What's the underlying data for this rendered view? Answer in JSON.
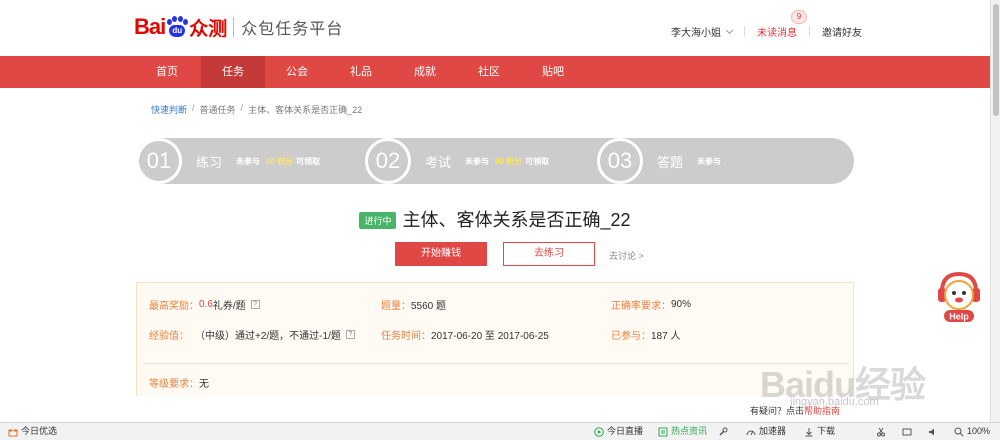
{
  "header": {
    "logo_bai": "Bai",
    "logo_du": "du",
    "logo_product": "众测",
    "logo_subtitle": "众包任务平台",
    "user_name": "李大海小姐",
    "unread_label": "未读消息",
    "unread_count": "9",
    "invite_label": "邀请好友"
  },
  "nav": {
    "items": [
      {
        "label": "首页"
      },
      {
        "label": "任务"
      },
      {
        "label": "公会"
      },
      {
        "label": "礼品"
      },
      {
        "label": "成就"
      },
      {
        "label": "社区"
      },
      {
        "label": "贴吧"
      }
    ],
    "active_index": 1
  },
  "breadcrumb": {
    "items": [
      "快速判断",
      "普通任务",
      "主体、客体关系是否正确_22"
    ]
  },
  "steps": [
    {
      "num": "01",
      "name": "练习",
      "status": "未参与",
      "score": "20 积分",
      "grab": "可领取"
    },
    {
      "num": "02",
      "name": "考试",
      "status": "未参与",
      "score": "50 积分",
      "grab": "可领取"
    },
    {
      "num": "03",
      "name": "答题",
      "status": "未参与"
    }
  ],
  "task": {
    "status_badge": "进行中",
    "title": "主体、客体关系是否正确_22",
    "start_button": "开始赚钱",
    "practice_button": "去练习",
    "discuss_link": "去讨论 >"
  },
  "info": {
    "reward_label": "最高奖励：",
    "reward_value": "0.6",
    "reward_unit": " 礼券/题",
    "qty_label": "题量：",
    "qty_value": "5560 题",
    "accuracy_label": "正确率要求：",
    "accuracy_value": "90%",
    "exp_label": "经验值：",
    "exp_value": "（中级）通过+2/题，不通过-1/题",
    "time_label": "任务时间：",
    "time_value": "2017-06-20 至 2017-06-25",
    "joined_label": "已参与：",
    "joined_value": "187 人",
    "level_label": "等级要求：",
    "level_value": "无",
    "qmark": "?"
  },
  "help": {
    "question": "有疑问？点击",
    "link": "帮助指南",
    "mascot_label": "Help"
  },
  "watermark": {
    "main": "Baidu经验",
    "sub": "jingyan.baidu.com"
  },
  "statusbar": {
    "left": "今日优选",
    "live": "今日直播",
    "hot": "热点资讯",
    "accelerator": "加速器",
    "download": "下载",
    "zoom": "100%"
  },
  "colors": {
    "brand_red": "#e04845",
    "step_gray": "#cccccc",
    "score_yellow": "#ffe45c",
    "badge_green": "#4ab36a"
  }
}
